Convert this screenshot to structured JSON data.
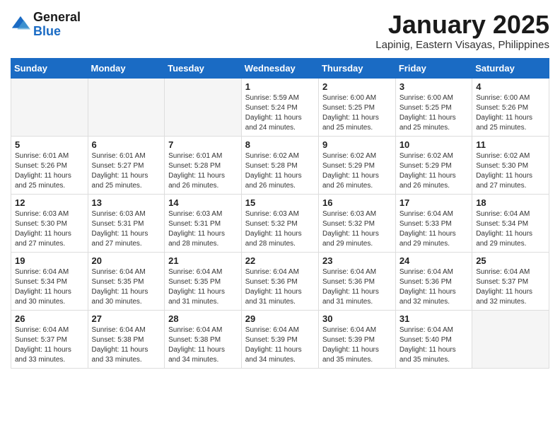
{
  "logo": {
    "line1": "General",
    "line2": "Blue"
  },
  "title": "January 2025",
  "subtitle": "Lapinig, Eastern Visayas, Philippines",
  "days_of_week": [
    "Sunday",
    "Monday",
    "Tuesday",
    "Wednesday",
    "Thursday",
    "Friday",
    "Saturday"
  ],
  "weeks": [
    [
      {
        "day": "",
        "info": ""
      },
      {
        "day": "",
        "info": ""
      },
      {
        "day": "",
        "info": ""
      },
      {
        "day": "1",
        "info": "Sunrise: 5:59 AM\nSunset: 5:24 PM\nDaylight: 11 hours and 24 minutes."
      },
      {
        "day": "2",
        "info": "Sunrise: 6:00 AM\nSunset: 5:25 PM\nDaylight: 11 hours and 25 minutes."
      },
      {
        "day": "3",
        "info": "Sunrise: 6:00 AM\nSunset: 5:25 PM\nDaylight: 11 hours and 25 minutes."
      },
      {
        "day": "4",
        "info": "Sunrise: 6:00 AM\nSunset: 5:26 PM\nDaylight: 11 hours and 25 minutes."
      }
    ],
    [
      {
        "day": "5",
        "info": "Sunrise: 6:01 AM\nSunset: 5:26 PM\nDaylight: 11 hours and 25 minutes."
      },
      {
        "day": "6",
        "info": "Sunrise: 6:01 AM\nSunset: 5:27 PM\nDaylight: 11 hours and 25 minutes."
      },
      {
        "day": "7",
        "info": "Sunrise: 6:01 AM\nSunset: 5:28 PM\nDaylight: 11 hours and 26 minutes."
      },
      {
        "day": "8",
        "info": "Sunrise: 6:02 AM\nSunset: 5:28 PM\nDaylight: 11 hours and 26 minutes."
      },
      {
        "day": "9",
        "info": "Sunrise: 6:02 AM\nSunset: 5:29 PM\nDaylight: 11 hours and 26 minutes."
      },
      {
        "day": "10",
        "info": "Sunrise: 6:02 AM\nSunset: 5:29 PM\nDaylight: 11 hours and 26 minutes."
      },
      {
        "day": "11",
        "info": "Sunrise: 6:02 AM\nSunset: 5:30 PM\nDaylight: 11 hours and 27 minutes."
      }
    ],
    [
      {
        "day": "12",
        "info": "Sunrise: 6:03 AM\nSunset: 5:30 PM\nDaylight: 11 hours and 27 minutes."
      },
      {
        "day": "13",
        "info": "Sunrise: 6:03 AM\nSunset: 5:31 PM\nDaylight: 11 hours and 27 minutes."
      },
      {
        "day": "14",
        "info": "Sunrise: 6:03 AM\nSunset: 5:31 PM\nDaylight: 11 hours and 28 minutes."
      },
      {
        "day": "15",
        "info": "Sunrise: 6:03 AM\nSunset: 5:32 PM\nDaylight: 11 hours and 28 minutes."
      },
      {
        "day": "16",
        "info": "Sunrise: 6:03 AM\nSunset: 5:32 PM\nDaylight: 11 hours and 29 minutes."
      },
      {
        "day": "17",
        "info": "Sunrise: 6:04 AM\nSunset: 5:33 PM\nDaylight: 11 hours and 29 minutes."
      },
      {
        "day": "18",
        "info": "Sunrise: 6:04 AM\nSunset: 5:34 PM\nDaylight: 11 hours and 29 minutes."
      }
    ],
    [
      {
        "day": "19",
        "info": "Sunrise: 6:04 AM\nSunset: 5:34 PM\nDaylight: 11 hours and 30 minutes."
      },
      {
        "day": "20",
        "info": "Sunrise: 6:04 AM\nSunset: 5:35 PM\nDaylight: 11 hours and 30 minutes."
      },
      {
        "day": "21",
        "info": "Sunrise: 6:04 AM\nSunset: 5:35 PM\nDaylight: 11 hours and 31 minutes."
      },
      {
        "day": "22",
        "info": "Sunrise: 6:04 AM\nSunset: 5:36 PM\nDaylight: 11 hours and 31 minutes."
      },
      {
        "day": "23",
        "info": "Sunrise: 6:04 AM\nSunset: 5:36 PM\nDaylight: 11 hours and 31 minutes."
      },
      {
        "day": "24",
        "info": "Sunrise: 6:04 AM\nSunset: 5:36 PM\nDaylight: 11 hours and 32 minutes."
      },
      {
        "day": "25",
        "info": "Sunrise: 6:04 AM\nSunset: 5:37 PM\nDaylight: 11 hours and 32 minutes."
      }
    ],
    [
      {
        "day": "26",
        "info": "Sunrise: 6:04 AM\nSunset: 5:37 PM\nDaylight: 11 hours and 33 minutes."
      },
      {
        "day": "27",
        "info": "Sunrise: 6:04 AM\nSunset: 5:38 PM\nDaylight: 11 hours and 33 minutes."
      },
      {
        "day": "28",
        "info": "Sunrise: 6:04 AM\nSunset: 5:38 PM\nDaylight: 11 hours and 34 minutes."
      },
      {
        "day": "29",
        "info": "Sunrise: 6:04 AM\nSunset: 5:39 PM\nDaylight: 11 hours and 34 minutes."
      },
      {
        "day": "30",
        "info": "Sunrise: 6:04 AM\nSunset: 5:39 PM\nDaylight: 11 hours and 35 minutes."
      },
      {
        "day": "31",
        "info": "Sunrise: 6:04 AM\nSunset: 5:40 PM\nDaylight: 11 hours and 35 minutes."
      },
      {
        "day": "",
        "info": ""
      }
    ]
  ]
}
